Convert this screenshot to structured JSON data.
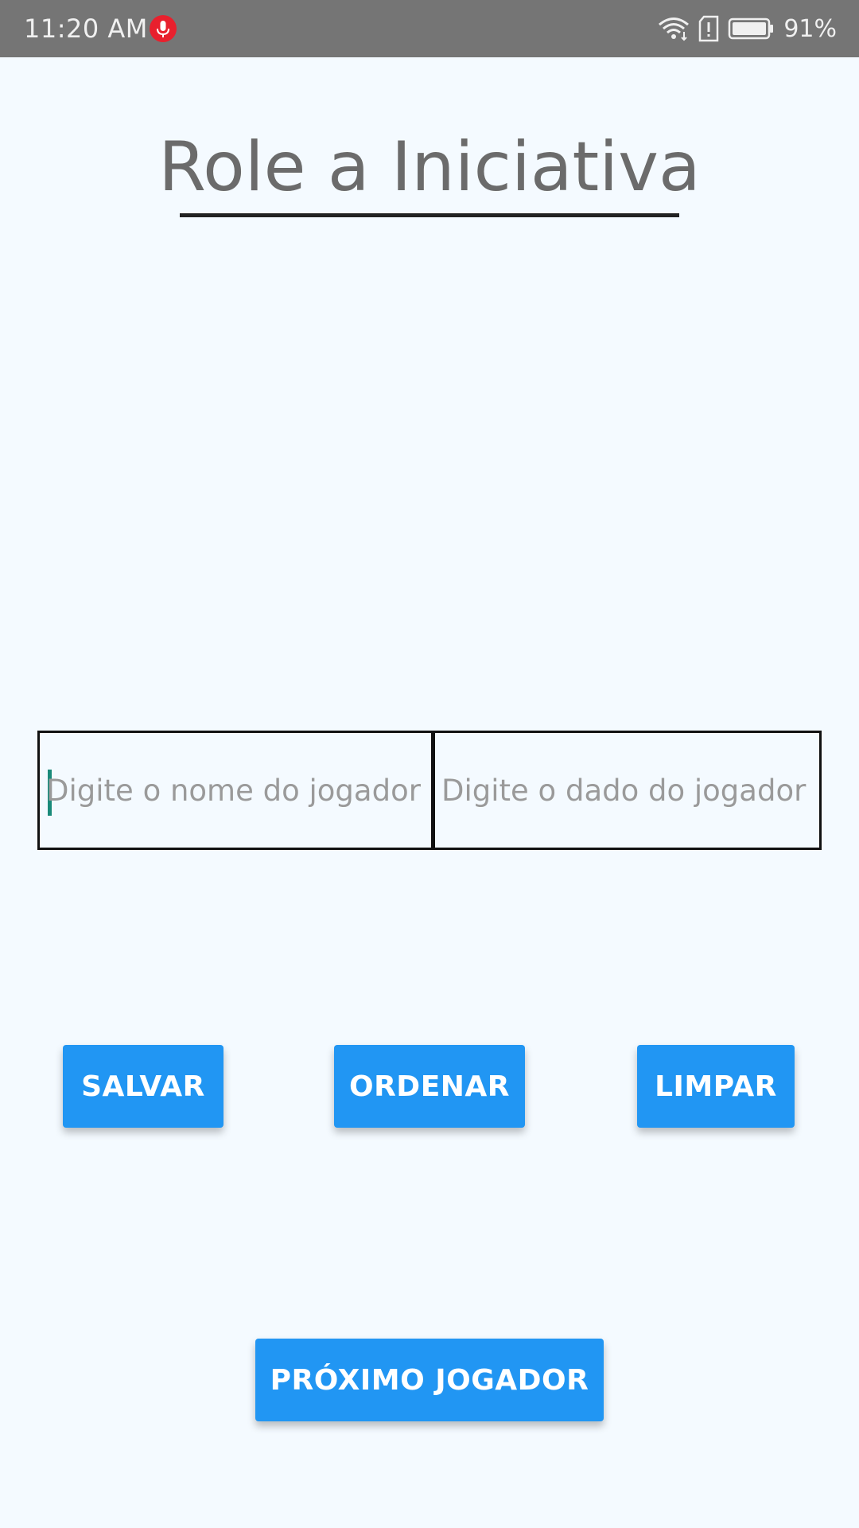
{
  "status_bar": {
    "time": "11:20 AM",
    "battery_percent": "91%",
    "icons": [
      "mic-icon",
      "wifi-icon",
      "sim-alert-icon",
      "battery-icon"
    ]
  },
  "title": "Role a Iniciativa",
  "inputs": {
    "player_name": {
      "value": "",
      "placeholder": "Digite o nome do jogador"
    },
    "player_dice": {
      "value": "",
      "placeholder": "Digite o dado do jogador"
    }
  },
  "buttons": {
    "save": "SALVAR",
    "sort": "ORDENAR",
    "clear": "LIMPAR",
    "next_player": "PRÓXIMO JOGADOR"
  },
  "colors": {
    "accent": "#2196f3",
    "status_bar": "#757575",
    "background": "#f4faff",
    "mic_badge": "#e8202d",
    "caret": "#1a8a7a"
  }
}
